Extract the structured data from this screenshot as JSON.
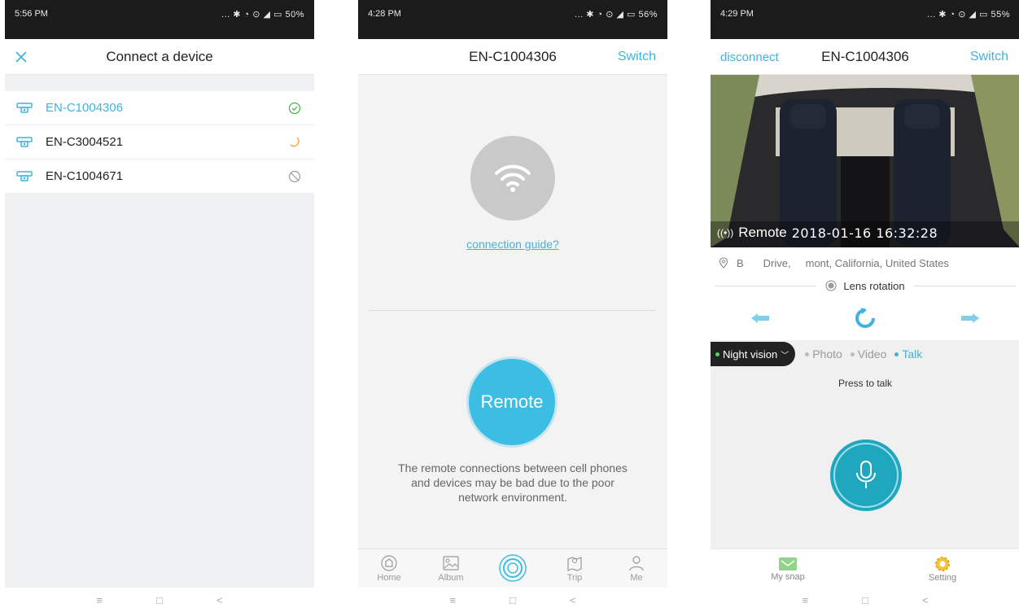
{
  "colors": {
    "accent": "#3fb3dd",
    "online": "#4caf50",
    "sleep": "#f0a030",
    "offline": "#999999",
    "remote_button": "#3cbde4",
    "mic_button": "#1fa7bf"
  },
  "screen1": {
    "status": {
      "time": "5:56 PM",
      "indicators": "... ✱ ◔ ⊙ ◢ ▭ 50%"
    },
    "title": "Connect a device",
    "close_icon": "close-icon",
    "devices": [
      {
        "name": "EN-C1004306",
        "status_icon": "check-circle-icon",
        "active": true
      },
      {
        "name": "EN-C3004521",
        "status_icon": "moon-icon",
        "active": false
      },
      {
        "name": "EN-C1004671",
        "status_icon": "blocked-icon",
        "active": false
      }
    ],
    "nav_keys": [
      "≡",
      "□",
      "<"
    ]
  },
  "screen2": {
    "status": {
      "time": "4:28 PM",
      "indicators": "... ✱ ◔ ⊙ ◢ ▭ 56%"
    },
    "title": "EN-C1004306",
    "switch": "Switch",
    "guide": "connection guide?",
    "remote": "Remote",
    "note": "The remote connections between cell phones and devices may be bad due to the poor network environment.",
    "tabs": [
      {
        "label": "Home",
        "icon": "home-icon"
      },
      {
        "label": "Album",
        "icon": "album-icon"
      },
      {
        "label": "",
        "icon": "connect-icon"
      },
      {
        "label": "Trip",
        "icon": "trip-icon"
      },
      {
        "label": "Me",
        "icon": "me-icon"
      }
    ],
    "nav_keys": [
      "≡",
      "□",
      "<"
    ]
  },
  "screen3": {
    "status": {
      "time": "4:29 PM",
      "indicators": "... ✱ ◔ ⊙ ◢ ▭ 55%"
    },
    "disconnect": "disconnect",
    "title": "EN-C1004306",
    "switch": "Switch",
    "overlay": {
      "mode": "Remote",
      "timestamp": "2018-01-16   16:32:28"
    },
    "address": {
      "part1": "B",
      "part2": "Drive,",
      "part3": "mont, California, United States"
    },
    "lens": "Lens rotation",
    "modes": {
      "night": "Night vision",
      "photo": "Photo",
      "video": "Video",
      "talk": "Talk"
    },
    "press": "Press to talk",
    "tabs": [
      {
        "label": "My snap",
        "icon": "snap-icon"
      },
      {
        "label": "Setting",
        "icon": "setting-icon"
      }
    ],
    "nav_keys": [
      "≡",
      "□",
      "<"
    ]
  }
}
